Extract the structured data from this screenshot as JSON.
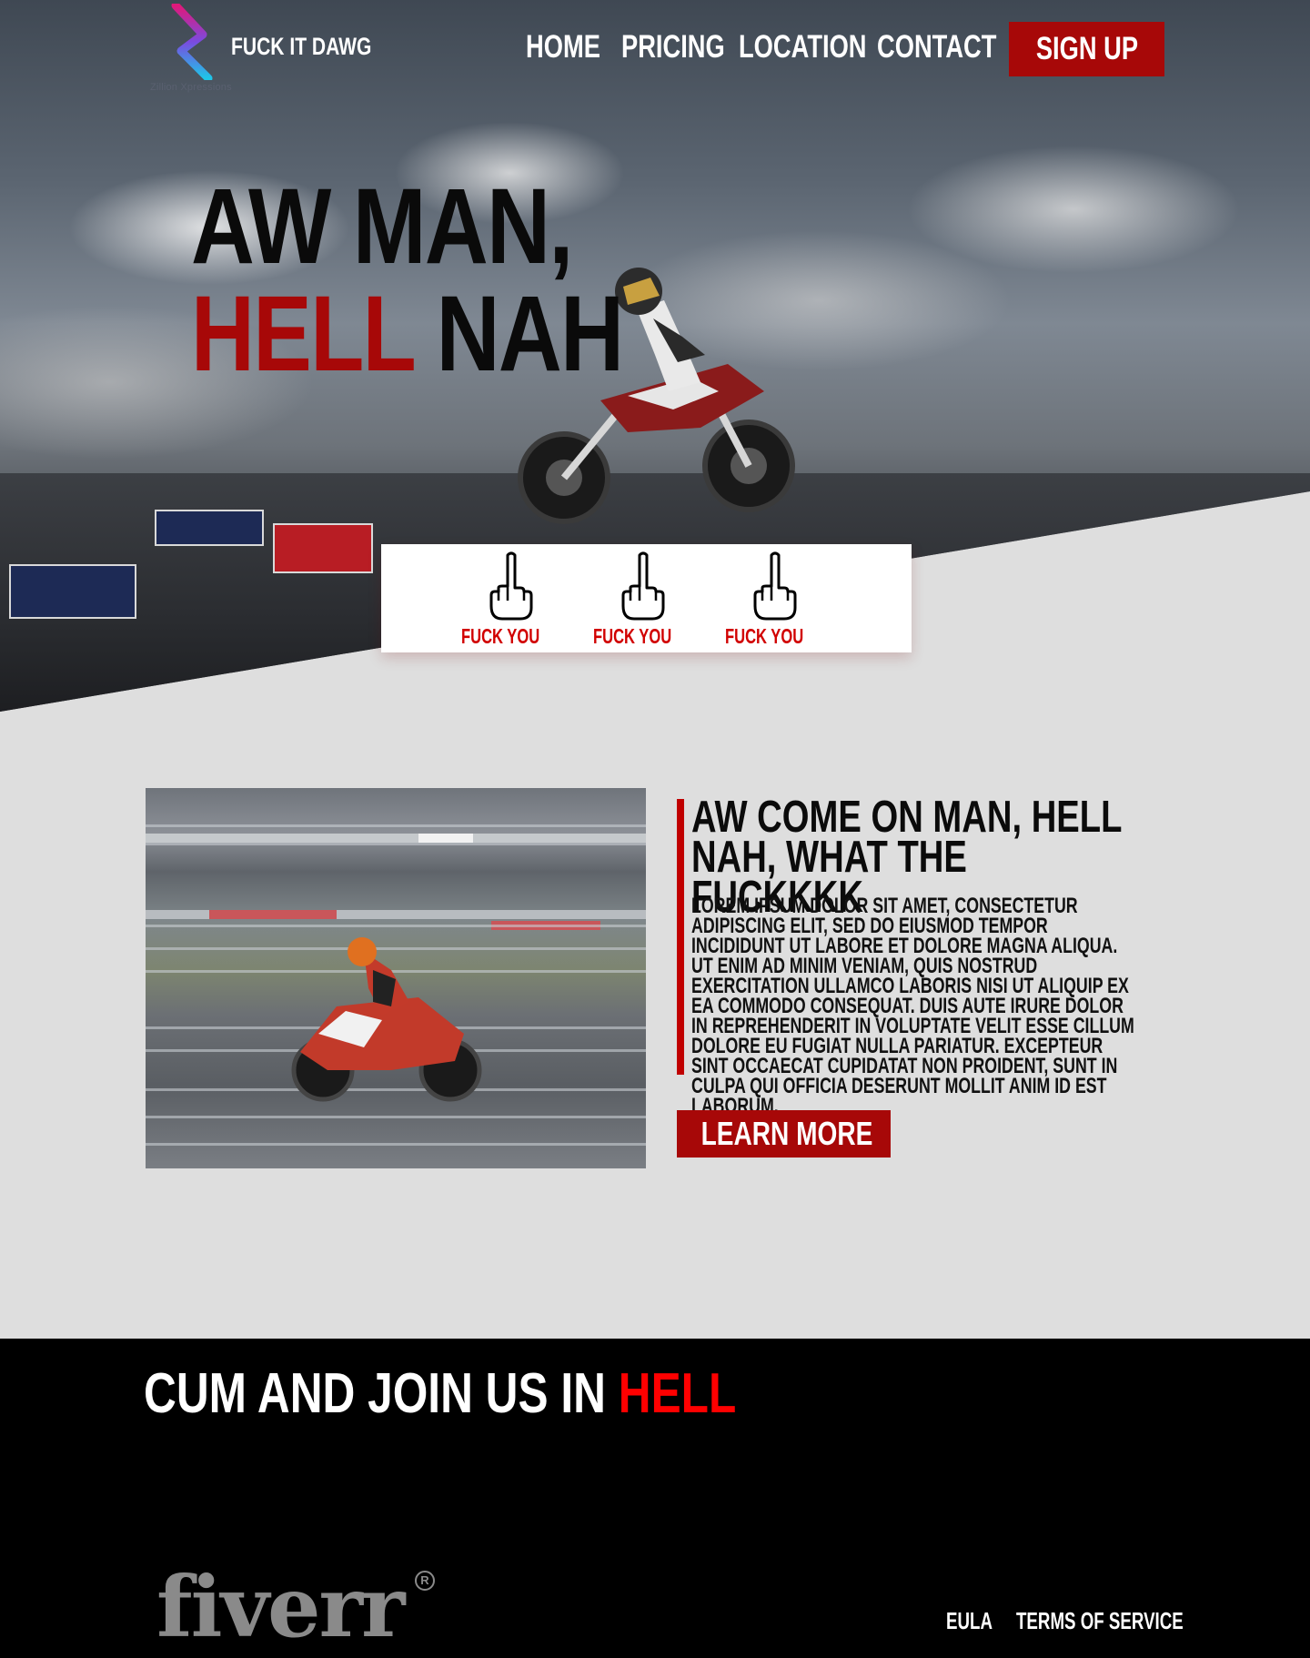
{
  "brand": {
    "name": "FUCK IT DAWG",
    "logo_sub": "Zillion Xpressions",
    "logo_icon": "z-logo-icon"
  },
  "nav": {
    "items": [
      {
        "label": "HOME"
      },
      {
        "label": "PRICING"
      },
      {
        "label": "LOCATION"
      },
      {
        "label": "CONTACT"
      }
    ],
    "cta_label": "SIGN UP"
  },
  "hero": {
    "line1": "AW MAN,",
    "line2_red": "HELL",
    "line2_rest": "NAH"
  },
  "card": {
    "items": [
      {
        "icon": "middle-finger-icon",
        "label": "FUCK YOU"
      },
      {
        "icon": "middle-finger-icon",
        "label": "FUCK YOU"
      },
      {
        "icon": "middle-finger-icon",
        "label": "FUCK YOU"
      }
    ]
  },
  "feature": {
    "title": "AW COME ON MAN, HELL NAH, WHAT THE FUCKKKK",
    "body": "LOREM IPSUM DOLOR SIT AMET, CONSECTETUR ADIPISCING ELIT, SED DO EIUSMOD TEMPOR INCIDIDUNT UT LABORE ET DOLORE MAGNA ALIQUA. UT ENIM AD MINIM VENIAM, QUIS NOSTRUD EXERCITATION ULLAMCO LABORIS NISI UT ALIQUIP EX EA COMMODO CONSEQUAT. DUIS AUTE IRURE DOLOR IN REPREHENDERIT IN VOLUPTATE VELIT ESSE CILLUM DOLORE EU FUGIAT NULLA PARIATUR. EXCEPTEUR SINT OCCAECAT CUPIDATAT NON PROIDENT, SUNT IN CULPA QUI OFFICIA DESERUNT MOLLIT ANIM ID EST LABORUM.",
    "button_label": "LEARN MORE"
  },
  "footer": {
    "title_white": "CUM AND JOIN US IN",
    "title_red": "HELL",
    "logo_text": "fiverr",
    "registered_mark": "R",
    "links": [
      {
        "label": "EULA"
      },
      {
        "label": "TERMS OF SERVICE"
      }
    ]
  },
  "colors": {
    "accent_red": "#a70808",
    "label_red": "#d10000",
    "highlight_red": "#ff0000",
    "background_gray": "#dedede",
    "footer_black": "#000000"
  }
}
